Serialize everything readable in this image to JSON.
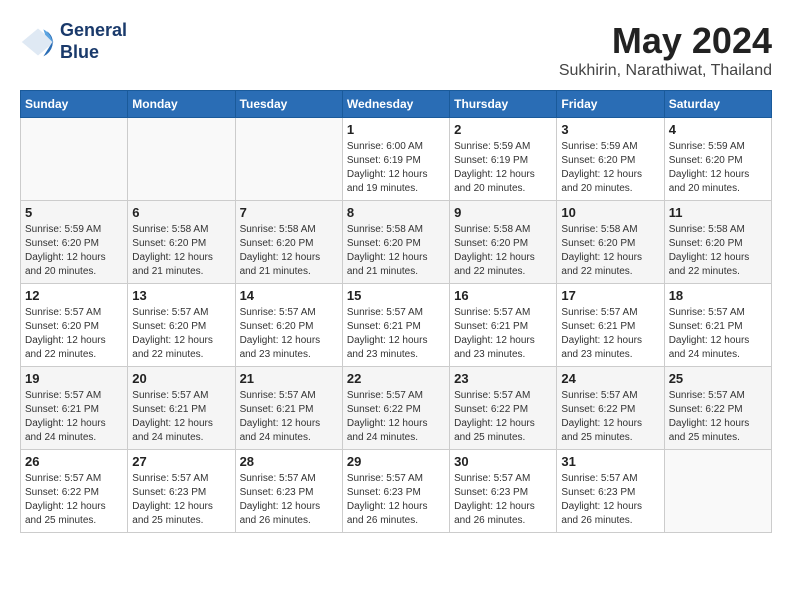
{
  "logo": {
    "line1": "General",
    "line2": "Blue"
  },
  "title": "May 2024",
  "location": "Sukhirin, Narathiwat, Thailand",
  "days_of_week": [
    "Sunday",
    "Monday",
    "Tuesday",
    "Wednesday",
    "Thursday",
    "Friday",
    "Saturday"
  ],
  "weeks": [
    [
      {
        "day": "",
        "info": ""
      },
      {
        "day": "",
        "info": ""
      },
      {
        "day": "",
        "info": ""
      },
      {
        "day": "1",
        "info": "Sunrise: 6:00 AM\nSunset: 6:19 PM\nDaylight: 12 hours and 19 minutes."
      },
      {
        "day": "2",
        "info": "Sunrise: 5:59 AM\nSunset: 6:19 PM\nDaylight: 12 hours and 20 minutes."
      },
      {
        "day": "3",
        "info": "Sunrise: 5:59 AM\nSunset: 6:20 PM\nDaylight: 12 hours and 20 minutes."
      },
      {
        "day": "4",
        "info": "Sunrise: 5:59 AM\nSunset: 6:20 PM\nDaylight: 12 hours and 20 minutes."
      }
    ],
    [
      {
        "day": "5",
        "info": "Sunrise: 5:59 AM\nSunset: 6:20 PM\nDaylight: 12 hours and 20 minutes."
      },
      {
        "day": "6",
        "info": "Sunrise: 5:58 AM\nSunset: 6:20 PM\nDaylight: 12 hours and 21 minutes."
      },
      {
        "day": "7",
        "info": "Sunrise: 5:58 AM\nSunset: 6:20 PM\nDaylight: 12 hours and 21 minutes."
      },
      {
        "day": "8",
        "info": "Sunrise: 5:58 AM\nSunset: 6:20 PM\nDaylight: 12 hours and 21 minutes."
      },
      {
        "day": "9",
        "info": "Sunrise: 5:58 AM\nSunset: 6:20 PM\nDaylight: 12 hours and 22 minutes."
      },
      {
        "day": "10",
        "info": "Sunrise: 5:58 AM\nSunset: 6:20 PM\nDaylight: 12 hours and 22 minutes."
      },
      {
        "day": "11",
        "info": "Sunrise: 5:58 AM\nSunset: 6:20 PM\nDaylight: 12 hours and 22 minutes."
      }
    ],
    [
      {
        "day": "12",
        "info": "Sunrise: 5:57 AM\nSunset: 6:20 PM\nDaylight: 12 hours and 22 minutes."
      },
      {
        "day": "13",
        "info": "Sunrise: 5:57 AM\nSunset: 6:20 PM\nDaylight: 12 hours and 22 minutes."
      },
      {
        "day": "14",
        "info": "Sunrise: 5:57 AM\nSunset: 6:20 PM\nDaylight: 12 hours and 23 minutes."
      },
      {
        "day": "15",
        "info": "Sunrise: 5:57 AM\nSunset: 6:21 PM\nDaylight: 12 hours and 23 minutes."
      },
      {
        "day": "16",
        "info": "Sunrise: 5:57 AM\nSunset: 6:21 PM\nDaylight: 12 hours and 23 minutes."
      },
      {
        "day": "17",
        "info": "Sunrise: 5:57 AM\nSunset: 6:21 PM\nDaylight: 12 hours and 23 minutes."
      },
      {
        "day": "18",
        "info": "Sunrise: 5:57 AM\nSunset: 6:21 PM\nDaylight: 12 hours and 24 minutes."
      }
    ],
    [
      {
        "day": "19",
        "info": "Sunrise: 5:57 AM\nSunset: 6:21 PM\nDaylight: 12 hours and 24 minutes."
      },
      {
        "day": "20",
        "info": "Sunrise: 5:57 AM\nSunset: 6:21 PM\nDaylight: 12 hours and 24 minutes."
      },
      {
        "day": "21",
        "info": "Sunrise: 5:57 AM\nSunset: 6:21 PM\nDaylight: 12 hours and 24 minutes."
      },
      {
        "day": "22",
        "info": "Sunrise: 5:57 AM\nSunset: 6:22 PM\nDaylight: 12 hours and 24 minutes."
      },
      {
        "day": "23",
        "info": "Sunrise: 5:57 AM\nSunset: 6:22 PM\nDaylight: 12 hours and 25 minutes."
      },
      {
        "day": "24",
        "info": "Sunrise: 5:57 AM\nSunset: 6:22 PM\nDaylight: 12 hours and 25 minutes."
      },
      {
        "day": "25",
        "info": "Sunrise: 5:57 AM\nSunset: 6:22 PM\nDaylight: 12 hours and 25 minutes."
      }
    ],
    [
      {
        "day": "26",
        "info": "Sunrise: 5:57 AM\nSunset: 6:22 PM\nDaylight: 12 hours and 25 minutes."
      },
      {
        "day": "27",
        "info": "Sunrise: 5:57 AM\nSunset: 6:23 PM\nDaylight: 12 hours and 25 minutes."
      },
      {
        "day": "28",
        "info": "Sunrise: 5:57 AM\nSunset: 6:23 PM\nDaylight: 12 hours and 26 minutes."
      },
      {
        "day": "29",
        "info": "Sunrise: 5:57 AM\nSunset: 6:23 PM\nDaylight: 12 hours and 26 minutes."
      },
      {
        "day": "30",
        "info": "Sunrise: 5:57 AM\nSunset: 6:23 PM\nDaylight: 12 hours and 26 minutes."
      },
      {
        "day": "31",
        "info": "Sunrise: 5:57 AM\nSunset: 6:23 PM\nDaylight: 12 hours and 26 minutes."
      },
      {
        "day": "",
        "info": ""
      }
    ]
  ]
}
